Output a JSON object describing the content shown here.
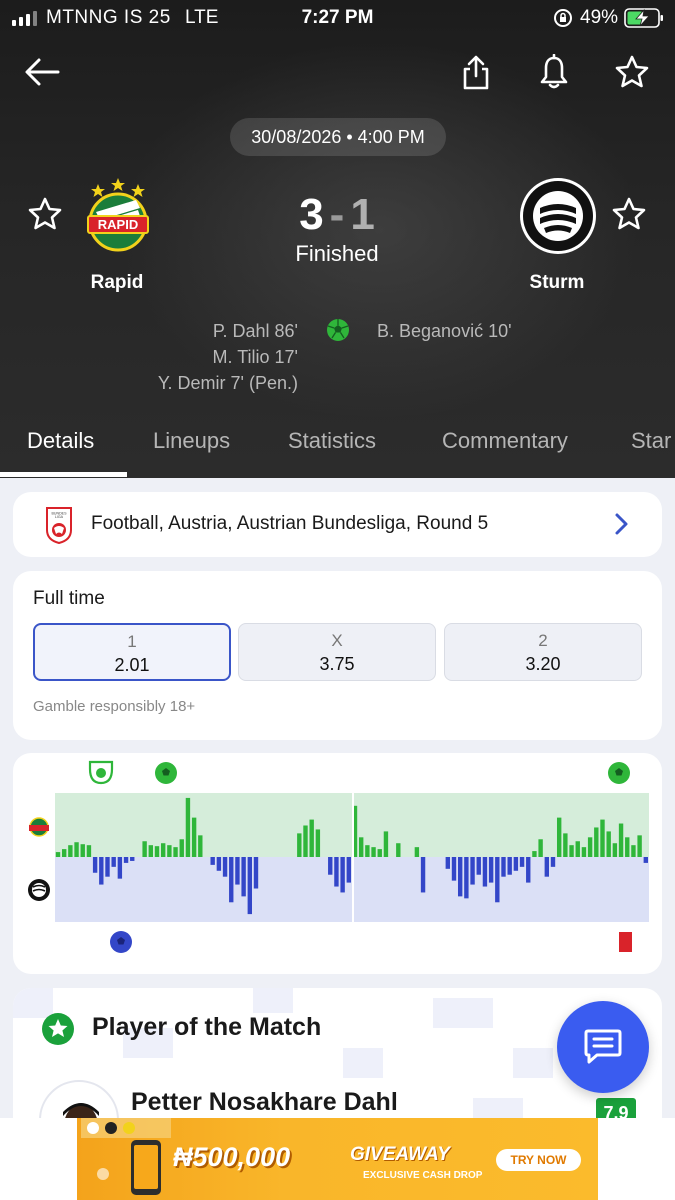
{
  "status_bar": {
    "carrier": "MTNNG IS 25",
    "network": "LTE",
    "time": "7:27 PM",
    "battery": "49%"
  },
  "match": {
    "datetime": "30/08/2026 • 4:00 PM",
    "home": {
      "name": "Rapid",
      "score": "3",
      "crest_text": "RAPID"
    },
    "away": {
      "name": "Sturm",
      "score": "1"
    },
    "separator": "-",
    "status": "Finished",
    "home_scorers": [
      "P. Dahl 86'",
      "M. Tilio 17'",
      "Y. Demir 7' (Pen.)"
    ],
    "away_scorers": [
      "B. Beganović 10'"
    ]
  },
  "tabs": [
    "Details",
    "Lineups",
    "Statistics",
    "Commentary",
    "Star"
  ],
  "league": {
    "text": "Football, Austria, Austrian Bundesliga, Round 5"
  },
  "odds": {
    "title": "Full time",
    "options": [
      {
        "label": "1",
        "value": "2.01",
        "selected": true
      },
      {
        "label": "X",
        "value": "3.75",
        "selected": false
      },
      {
        "label": "2",
        "value": "3.20",
        "selected": false
      }
    ],
    "disclaimer": "Gamble responsibly 18+"
  },
  "momentum": {
    "home_color": "#2fb63a",
    "away_color": "#3346c8",
    "home_bg": "#d5edda",
    "away_bg": "#dbe0f6",
    "home_values": [
      5,
      8,
      12,
      15,
      13,
      12,
      0,
      0,
      0,
      0,
      0,
      0,
      0,
      0,
      16,
      12,
      11,
      14,
      12,
      10,
      18,
      60,
      40,
      22,
      0,
      0,
      0,
      0,
      0,
      0,
      0,
      0,
      0,
      0,
      0,
      0,
      0,
      0,
      0,
      24,
      32,
      38,
      28,
      0,
      0,
      0,
      0,
      0,
      52,
      20,
      12,
      10,
      8,
      26,
      0,
      14,
      0,
      0,
      10,
      0,
      0,
      0,
      0,
      0,
      0,
      0,
      0,
      0,
      0,
      0,
      0,
      0,
      0,
      0,
      0,
      0,
      0,
      6,
      18,
      0,
      0,
      40,
      24,
      12,
      16,
      10,
      20,
      30,
      38,
      26,
      14,
      34,
      20,
      12,
      22,
      0
    ],
    "away_values": [
      0,
      0,
      0,
      0,
      0,
      0,
      16,
      28,
      20,
      10,
      22,
      6,
      4,
      0,
      0,
      0,
      0,
      0,
      0,
      0,
      0,
      0,
      0,
      0,
      0,
      8,
      14,
      20,
      46,
      28,
      40,
      58,
      32,
      0,
      0,
      0,
      0,
      0,
      0,
      0,
      0,
      0,
      0,
      0,
      18,
      30,
      36,
      26,
      0,
      0,
      0,
      0,
      0,
      0,
      0,
      0,
      0,
      0,
      0,
      36,
      0,
      0,
      0,
      12,
      24,
      40,
      42,
      28,
      18,
      30,
      26,
      46,
      20,
      18,
      14,
      10,
      26,
      0,
      0,
      20,
      10,
      0,
      0,
      0,
      0,
      0,
      0,
      0,
      0,
      0,
      0,
      0,
      0,
      0,
      0,
      6
    ],
    "events_home_top": [
      "save-icon",
      "goal-icon",
      "goal-icon"
    ],
    "events_away_bottom": [
      "goal-icon",
      "red-card-icon"
    ]
  },
  "player_of_match": {
    "title": "Player of the Match",
    "name": "Petter Nosakhare Dahl",
    "rating": "7.9"
  },
  "ad": {
    "amount": "₦500,000",
    "headline": "GIVEAWAY",
    "sub": "EXCLUSIVE CASH DROP",
    "cta": "TRY NOW"
  }
}
